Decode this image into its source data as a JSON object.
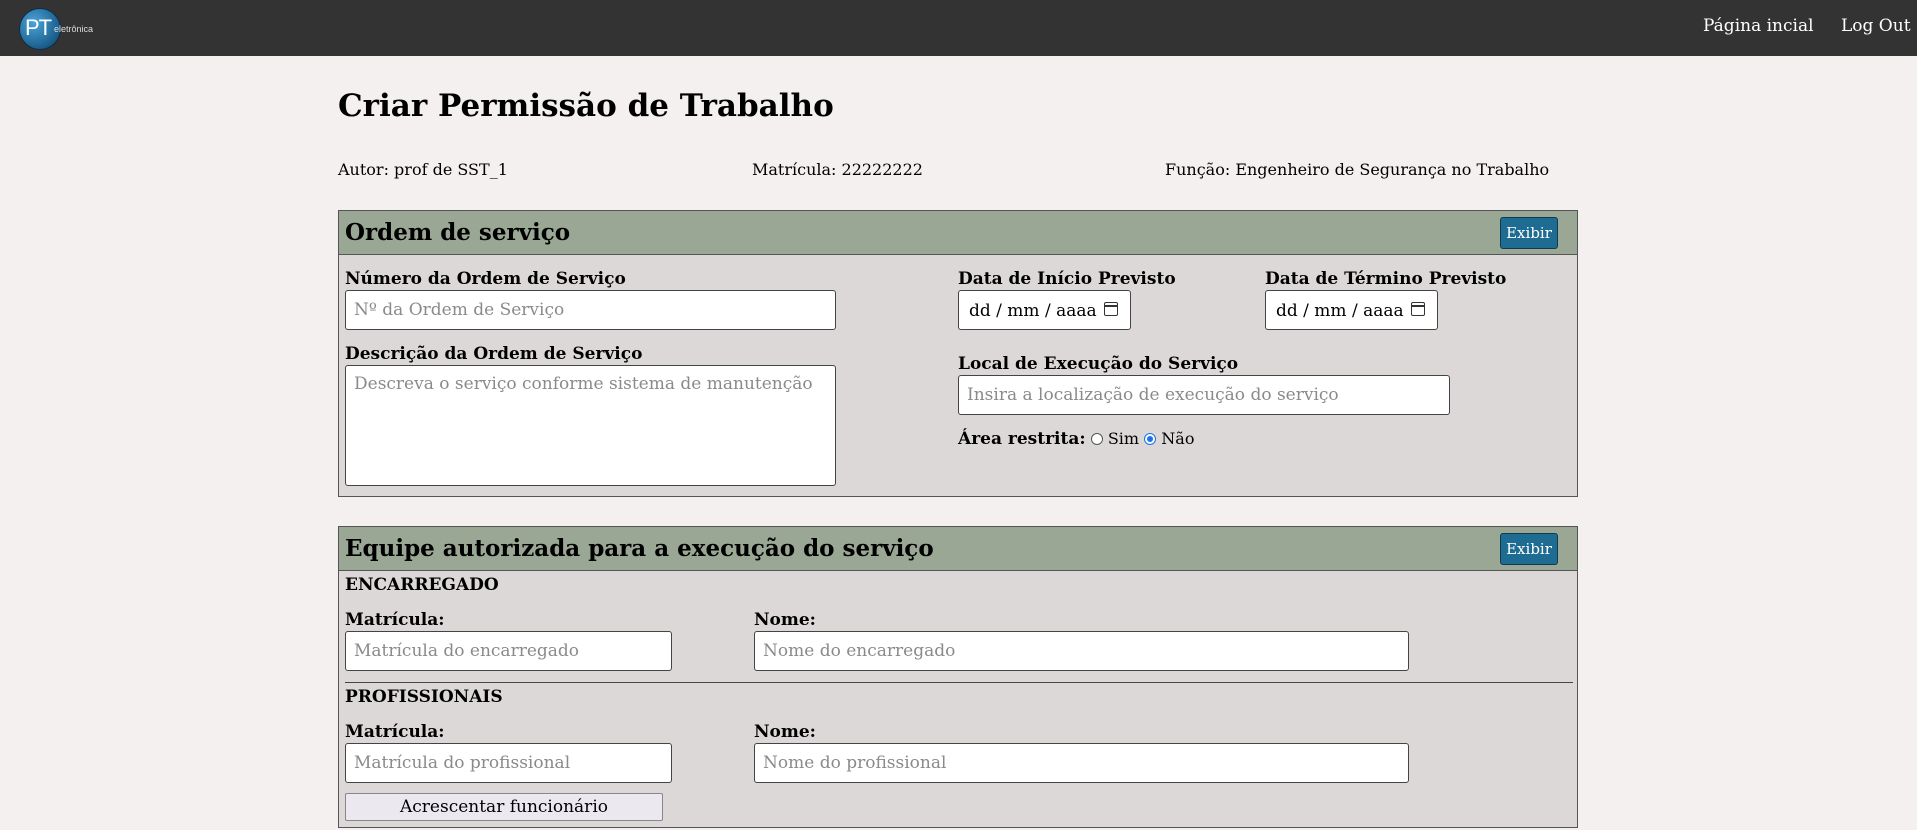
{
  "navbar": {
    "logo_text": "PT",
    "logo_subtext": "eletrônica",
    "home_link": "Página incial",
    "logout_link": "Log Out"
  },
  "page": {
    "title": "Criar Permissão de Trabalho",
    "autor": "Autor: prof de SST_1",
    "matricula": "Matrícula: 22222222",
    "funcao": "Função: Engenheiro de Segurança no Trabalho"
  },
  "ordem_servico": {
    "title": "Ordem de serviço",
    "toggle_label": "Exibir",
    "numero_label": "Número da Ordem de Serviço",
    "numero_placeholder": "Nº da Ordem de Serviço",
    "descricao_label": "Descrição da Ordem de Serviço",
    "descricao_placeholder": "Descreva o serviço conforme sistema de manutenção",
    "inicio_label": "Data de Início Previsto",
    "inicio_value": "dd / mm / aaaa",
    "termino_label": "Data de Término Previsto",
    "termino_value": "dd / mm / aaaa",
    "local_label": "Local de Execução do Serviço",
    "local_placeholder": "Insira a localização de execução do serviço",
    "area_label": "Área restrita:",
    "area_options": [
      "Sim",
      "Não"
    ],
    "area_selected": "Não"
  },
  "equipe": {
    "title": "Equipe autorizada para a execução do serviço",
    "toggle_label": "Exibir",
    "encarregado_heading": "ENCARREGADO",
    "encarregado_matricula_label": "Matrícula:",
    "encarregado_matricula_placeholder": "Matrícula do encarregado",
    "encarregado_nome_label": "Nome:",
    "encarregado_nome_placeholder": "Nome do encarregado",
    "profissionais_heading": "PROFISSIONAIS",
    "prof_matricula_label": "Matrícula:",
    "prof_matricula_placeholder": "Matrícula do profissional",
    "prof_nome_label": "Nome:",
    "prof_nome_placeholder": "Nome do profissional",
    "add_button": "Acrescentar funcionário"
  },
  "colors": {
    "navbar_bg": "#333333",
    "section_header_bg": "#9aa794",
    "section_body_bg": "#dcd8d8",
    "button_bg": "#1f6c93",
    "page_bg": "#f4f0f0"
  }
}
